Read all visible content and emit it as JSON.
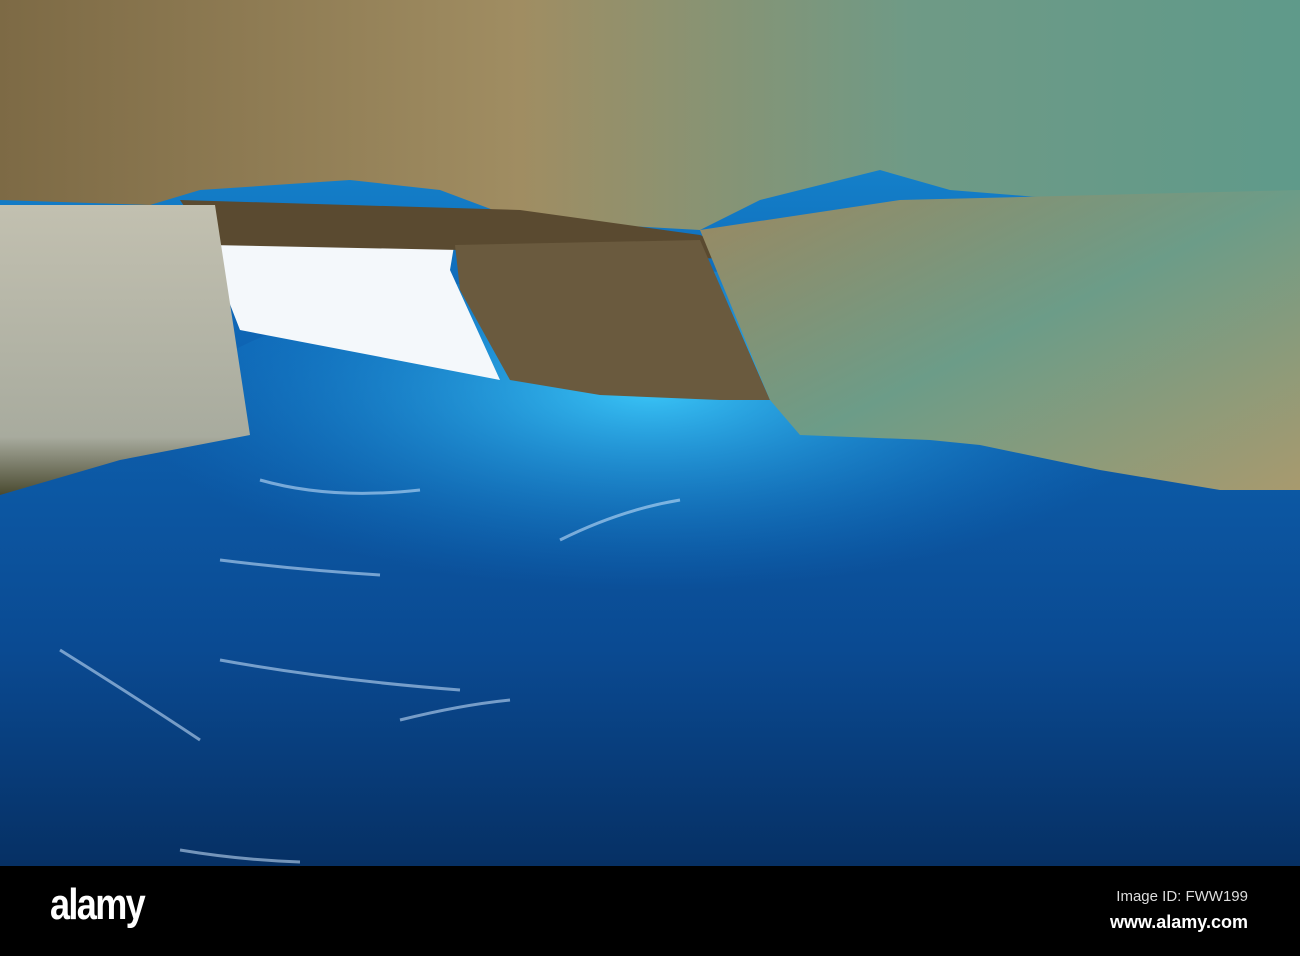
{
  "watermark": {
    "logo": "alamy",
    "image_id": "Image ID: FWW199",
    "site": "www.alamy.com"
  },
  "colors": {
    "water_deep": "#0a3a78",
    "water_bright": "#1aa8e8",
    "rock": "#9a8a60",
    "rock_teal": "#4f8a7a",
    "opening": "#f4f8fb"
  }
}
